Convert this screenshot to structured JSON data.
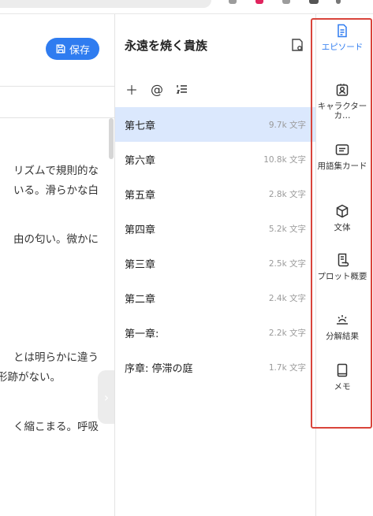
{
  "editor": {
    "save_label": "保存",
    "lines": [
      "リズムで規則的な",
      "いる。滑らかな白",
      "由の匂い。微かに",
      "とは明らかに違う",
      "形跡がない。",
      "く縮こまる。呼吸"
    ]
  },
  "panel": {
    "title": "永遠を焼く貴族",
    "chapters": [
      {
        "name": "第七章",
        "count": "9.7k 文字",
        "active": true
      },
      {
        "name": "第六章",
        "count": "10.8k 文字"
      },
      {
        "name": "第五章",
        "count": "2.8k 文字"
      },
      {
        "name": "第四章",
        "count": "5.2k 文字"
      },
      {
        "name": "第三章",
        "count": "2.5k 文字"
      },
      {
        "name": "第二章",
        "count": "2.4k 文字"
      },
      {
        "name": "第一章:",
        "count": "2.2k 文字"
      },
      {
        "name": "序章: 停滞の庭",
        "count": "1.7k 文字"
      }
    ]
  },
  "rail": {
    "items": [
      {
        "label": "エピソード",
        "icon": "document-icon",
        "active": true
      },
      {
        "label": "キャラクターカ…",
        "icon": "character-card-icon"
      },
      {
        "label": "用語集カード",
        "icon": "glossary-card-icon"
      },
      {
        "label": "文体",
        "icon": "cube-icon"
      },
      {
        "label": "プロット概要",
        "icon": "scroll-icon"
      },
      {
        "label": "分解結果",
        "icon": "breakdown-icon"
      },
      {
        "label": "メモ",
        "icon": "notebook-icon"
      }
    ],
    "accent": "#2f7cf0",
    "highlight_border": "#d9443b"
  }
}
